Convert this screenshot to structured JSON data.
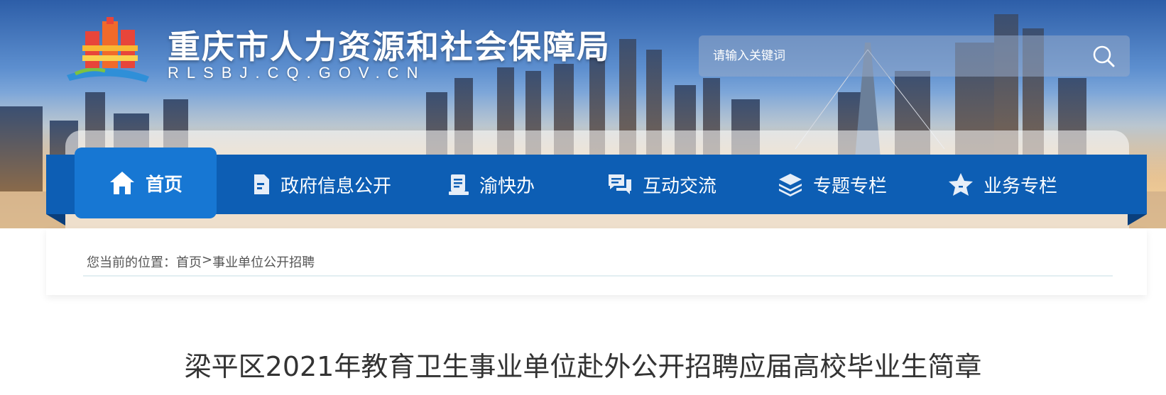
{
  "header": {
    "site_title": "重庆市人力资源和社会保障局",
    "site_domain": "RLSBJ.CQ.GOV.CN",
    "logo_icon": "government-emblem-logo"
  },
  "search": {
    "placeholder": "请输入关键词",
    "button_icon": "search-icon"
  },
  "nav": {
    "items": [
      {
        "label": "首页",
        "icon": "home-icon",
        "active": true
      },
      {
        "label": "政府信息公开",
        "icon": "document-icon",
        "active": false
      },
      {
        "label": "渝快办",
        "icon": "clipboard-icon",
        "active": false
      },
      {
        "label": "互动交流",
        "icon": "chat-icon",
        "active": false
      },
      {
        "label": "专题专栏",
        "icon": "layers-icon",
        "active": false
      },
      {
        "label": "业务专栏",
        "icon": "star-icon",
        "active": false
      }
    ]
  },
  "breadcrumb": {
    "prefix": "您当前的位置：",
    "items": [
      "首页",
      ">",
      "事业单位公开招聘"
    ]
  },
  "article": {
    "title": "梁平区2021年教育卫生事业单位赴外公开招聘应届高校毕业生简章"
  },
  "colors": {
    "nav_bg": "#0d5eb4",
    "nav_active": "#1777d3",
    "title_text": "#333333"
  }
}
